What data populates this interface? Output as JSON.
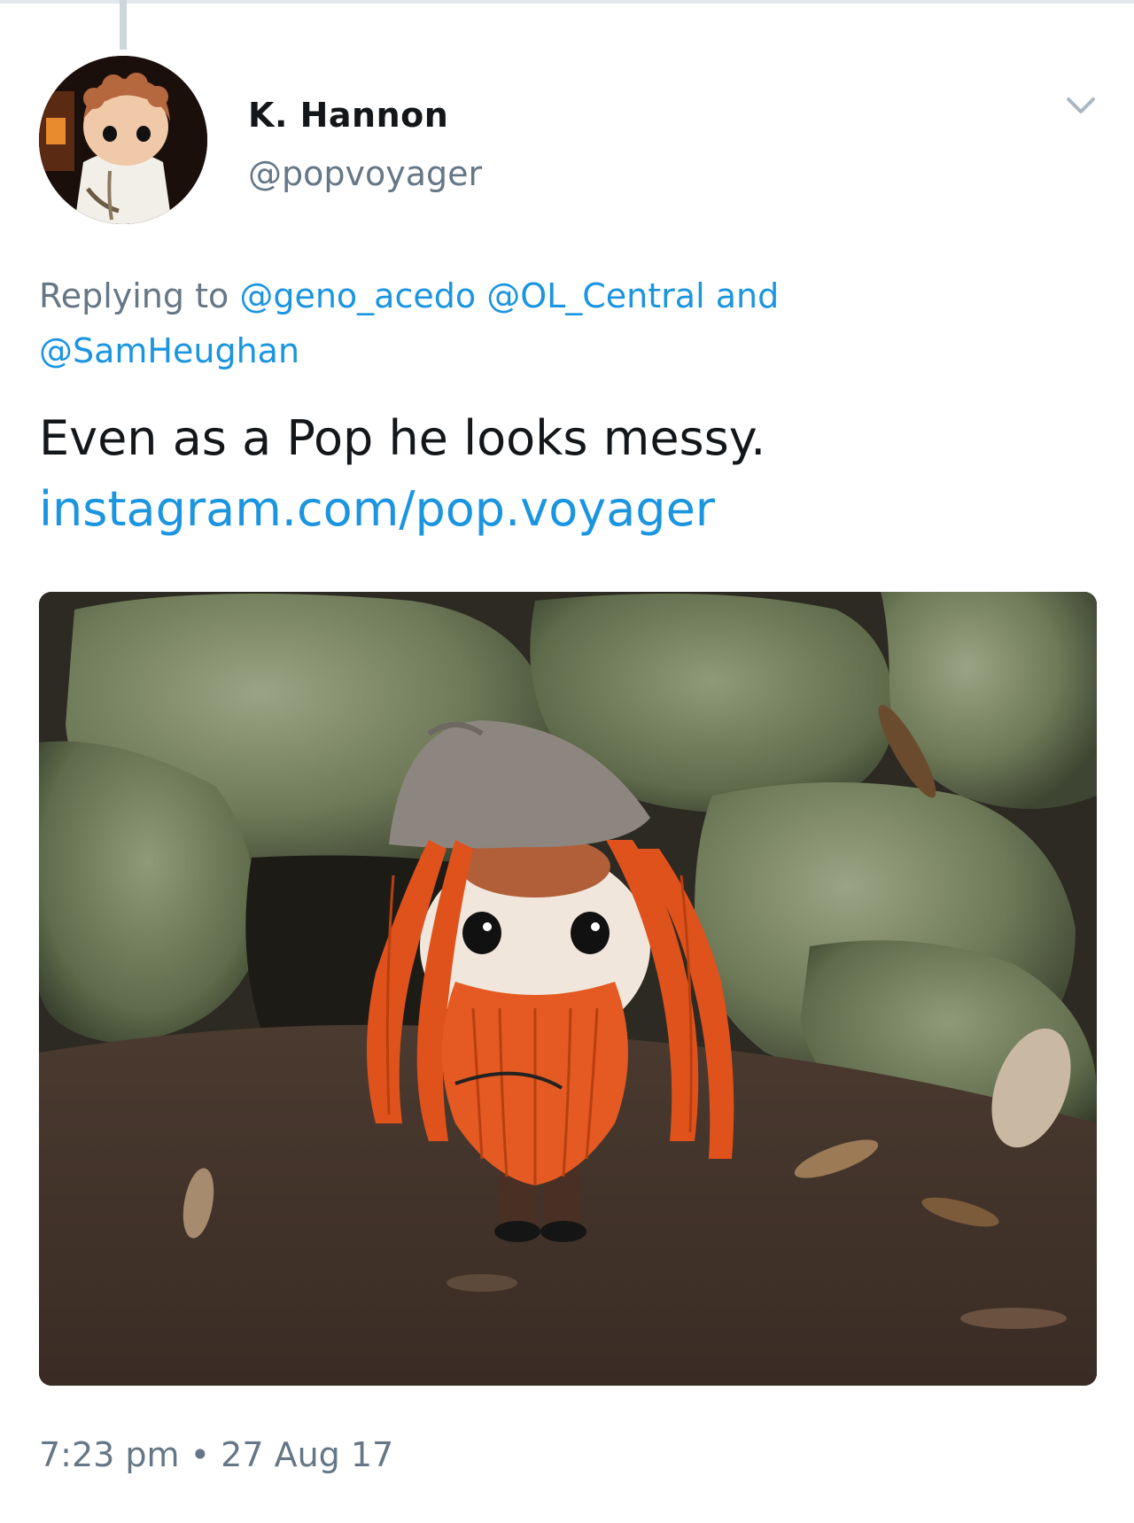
{
  "tweet": {
    "display_name": "K. Hannon",
    "handle": "@popvoyager",
    "reply": {
      "prefix": "Replying to",
      "mention_1": "@geno_acedo",
      "mention_2": "@OL_Central",
      "connector": "and",
      "mention_3": "@SamHeughan"
    },
    "text": "Even as a Pop he looks messy.",
    "link": "instagram.com/pop.voyager",
    "time": "7:23 pm",
    "separator": "•",
    "date": "27 Aug 17"
  },
  "icons": {
    "caret": "chevron-down-icon"
  },
  "colors": {
    "link": "#1b95e0",
    "secondary_text": "#657786",
    "primary_text": "#14171a",
    "hair": "#e0521c",
    "beanie": "#8d8680",
    "rock": "#6f7a58"
  }
}
